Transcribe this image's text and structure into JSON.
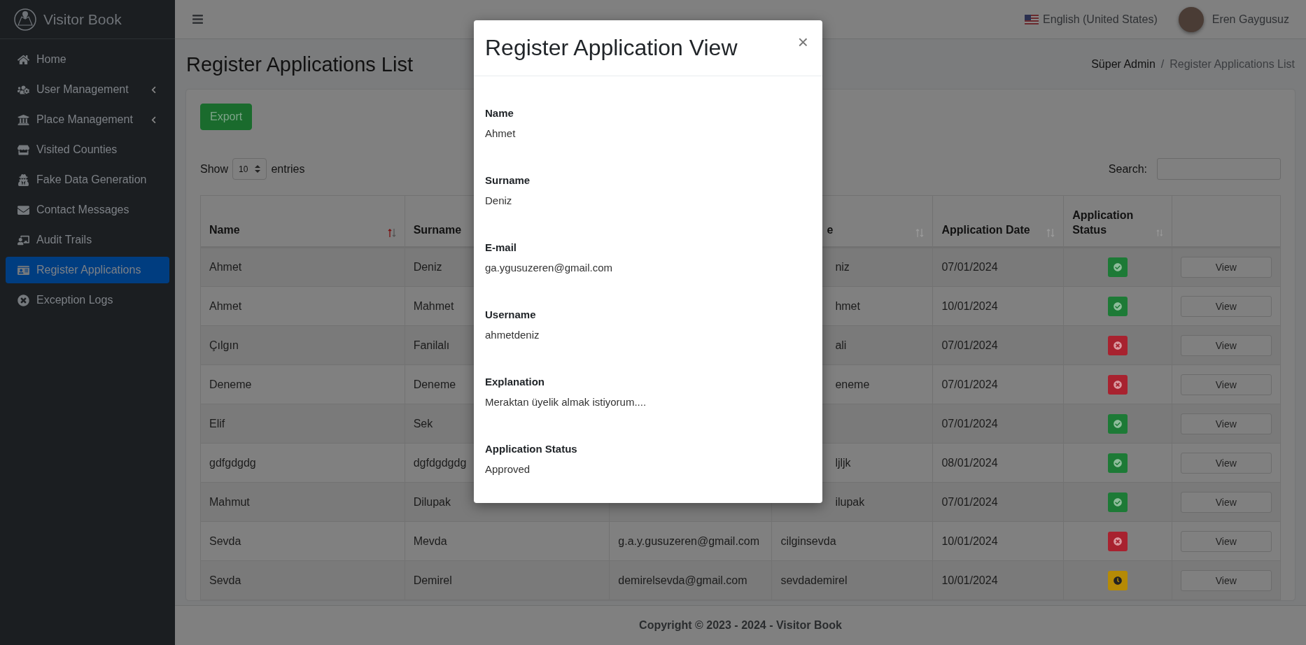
{
  "brand": {
    "title": "Visitor Book"
  },
  "sidebar": {
    "items": [
      {
        "label": "Home",
        "selected": false,
        "has_submenu": false
      },
      {
        "label": "User Management",
        "selected": false,
        "has_submenu": true
      },
      {
        "label": "Place Management",
        "selected": false,
        "has_submenu": true
      },
      {
        "label": "Visited Counties",
        "selected": false,
        "has_submenu": false
      },
      {
        "label": "Fake Data Generation",
        "selected": false,
        "has_submenu": false
      },
      {
        "label": "Contact Messages",
        "selected": false,
        "has_submenu": false
      },
      {
        "label": "Audit Trails",
        "selected": false,
        "has_submenu": false
      },
      {
        "label": "Register Applications",
        "selected": true,
        "has_submenu": false
      },
      {
        "label": "Exception Logs",
        "selected": false,
        "has_submenu": false
      }
    ]
  },
  "topbar": {
    "language": "English (United States)",
    "user": "Eren Gaygusuz"
  },
  "page": {
    "title": "Register Applications List",
    "breadcrumb": [
      "Süper Admin",
      "Register Applications List"
    ],
    "breadcrumb_separator": "/"
  },
  "toolbar": {
    "export": "Export",
    "show_label": "Show",
    "page_size": "10",
    "entries_label": "entries",
    "search_label": "Search:"
  },
  "table": {
    "columns": [
      {
        "label": "Name",
        "sortable": true,
        "sorted": true
      },
      {
        "label": "Surname"
      },
      {},
      {
        "label": "e",
        "sortable": true,
        "sorted": false
      },
      {
        "label": "Application Date",
        "sortable": true,
        "sorted": false
      },
      {
        "label": "Application Status",
        "sortable": true,
        "sorted": false
      },
      {}
    ],
    "rows": [
      {
        "kind": "approved",
        "name": "Ahmet",
        "surname": "Deniz",
        "username": "niz",
        "date": "07/01/2024",
        "action": "View"
      },
      {
        "kind": "approved",
        "name": "Ahmet",
        "surname": "Mahmet",
        "username": "hmet",
        "date": "10/01/2024",
        "action": "View"
      },
      {
        "kind": "rejected",
        "name": "Çılgın",
        "surname": "Fanilalı",
        "username": "ali",
        "date": "07/01/2024",
        "action": "View"
      },
      {
        "kind": "rejected",
        "name": "Deneme",
        "surname": "Deneme",
        "username": "eneme",
        "date": "07/01/2024",
        "action": "View"
      },
      {
        "kind": "approved",
        "name": "Elif",
        "surname": "Sek",
        "date": "07/01/2024",
        "action": "View"
      },
      {
        "kind": "approved",
        "name": "gdfgdgdg",
        "surname": "dgfdgdgdg",
        "username": "ljljk",
        "date": "08/01/2024",
        "action": "View"
      },
      {
        "kind": "approved",
        "name": "Mahmut",
        "surname": "Dilupak",
        "username": "ilupak",
        "date": "07/01/2024",
        "action": "View"
      },
      {
        "kind": "rejected",
        "name": "Sevda",
        "surname": "Mevda",
        "email": "g.a.y.gusuzeren@gmail.com",
        "username": "cilginsevda",
        "date": "10/01/2024",
        "action": "View"
      },
      {
        "kind": "pending",
        "name": "Sevda",
        "surname": "Demirel",
        "email": "demirelsevda@gmail.com",
        "username": "sevdademirel",
        "date": "10/01/2024",
        "action": "View"
      }
    ]
  },
  "footer": {
    "text": "Copyright © 2023 - 2024 - Visitor Book"
  },
  "modal": {
    "title": "Register Application View",
    "close": "×",
    "fields": [
      {
        "label": "Name",
        "value": "Ahmet"
      },
      {
        "label": "Surname",
        "value": "Deniz"
      },
      {
        "label": "E-mail",
        "value": "ga.ygusuzeren@gmail.com"
      },
      {
        "label": "Username",
        "value": "ahmetdeniz"
      },
      {
        "label": "Explanation",
        "value": "Meraktan üyelik almak istiyorum...."
      },
      {
        "label": "Application Status",
        "value": "Approved"
      }
    ]
  }
}
